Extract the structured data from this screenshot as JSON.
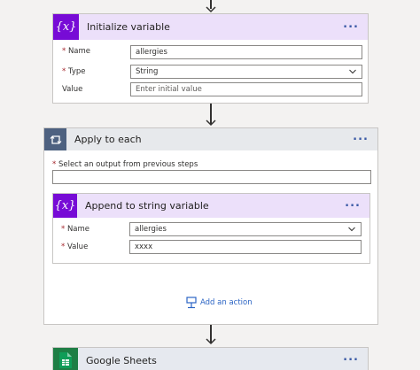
{
  "init_variable": {
    "title": "Initialize variable",
    "name_label": "Name",
    "name_value": "allergies",
    "type_label": "Type",
    "type_value": "String",
    "value_label": "Value",
    "value_placeholder": "Enter initial value"
  },
  "apply_to_each": {
    "title": "Apply to each",
    "select_label": "Select an output from previous steps",
    "select_value": "",
    "add_action_label": "Add an action"
  },
  "append_variable": {
    "title": "Append to string variable",
    "name_label": "Name",
    "name_value": "allergies",
    "value_label": "Value",
    "value_value": "xxxx"
  },
  "google_sheets": {
    "title": "Google Sheets"
  },
  "menu_glyph": "···",
  "var_glyph": "{x}",
  "required_mark": "*",
  "colors": {
    "variable_accent": "#770bd6",
    "loop_accent": "#4d6180",
    "sheets_accent": "#1e7e45",
    "link": "#2b64c4"
  }
}
